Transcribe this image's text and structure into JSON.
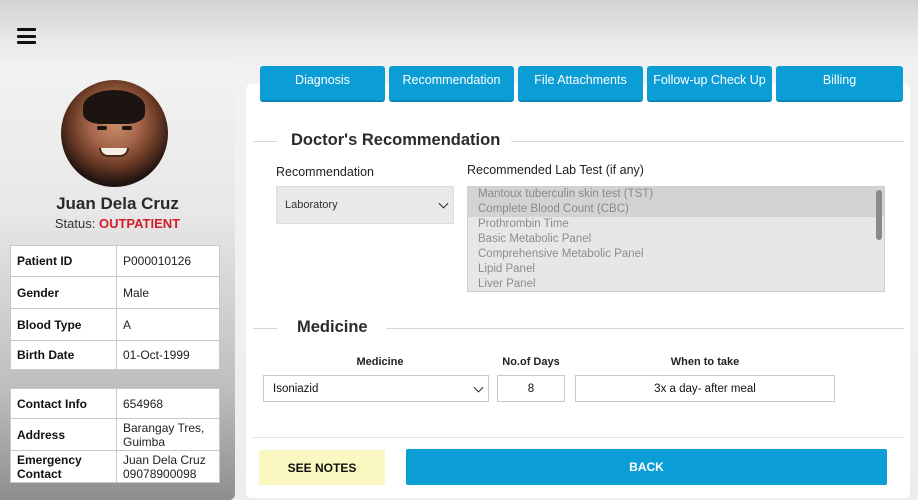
{
  "patient": {
    "name": "Juan Dela Cruz",
    "status_label": "Status:",
    "status_value": "OUTPATIENT",
    "details": [
      {
        "label": "Patient ID",
        "value": "P000010126"
      },
      {
        "label": "Gender",
        "value": "Male"
      },
      {
        "label": "Blood Type",
        "value": "A"
      },
      {
        "label": "Birth Date",
        "value": "01-Oct-1999"
      }
    ],
    "contact": [
      {
        "label": "Contact Info",
        "value": "654968"
      },
      {
        "label": "Address",
        "value": "Barangay Tres, Guimba"
      },
      {
        "label": "Emergency Contact",
        "value": "Juan Dela Cruz 09078900098"
      }
    ]
  },
  "tabs": [
    "Diagnosis",
    "Recommendation",
    "File Attachments",
    "Follow-up Check Up",
    "Billing"
  ],
  "recommendation": {
    "section_title": "Doctor's Recommendation",
    "recommendation_label": "Recommendation",
    "recommendation_value": "Laboratory",
    "lab_label": "Recommended Lab Test (if any)",
    "lab_options": [
      {
        "text": "Mantoux tuberculin skin test (TST)",
        "selected": true
      },
      {
        "text": "Complete Blood Count (CBC)",
        "selected": true
      },
      {
        "text": "Prothrombin Time",
        "selected": false
      },
      {
        "text": "Basic Metabolic Panel",
        "selected": false
      },
      {
        "text": "Comprehensive Metabolic Panel",
        "selected": false
      },
      {
        "text": "Lipid Panel",
        "selected": false
      },
      {
        "text": "Liver Panel",
        "selected": false
      }
    ]
  },
  "medicine": {
    "section_title": "Medicine",
    "col_medicine": "Medicine",
    "col_days": "No.of Days",
    "col_when": "When to take",
    "medicine_value": "Isoniazid",
    "days_value": "8",
    "when_value": "3x a day- after meal"
  },
  "buttons": {
    "see_notes": "SEE NOTES",
    "back": "BACK"
  },
  "colors": {
    "accent": "#0b9ed6",
    "status": "#d21d2a",
    "notes_bg": "#fbf7c0"
  }
}
